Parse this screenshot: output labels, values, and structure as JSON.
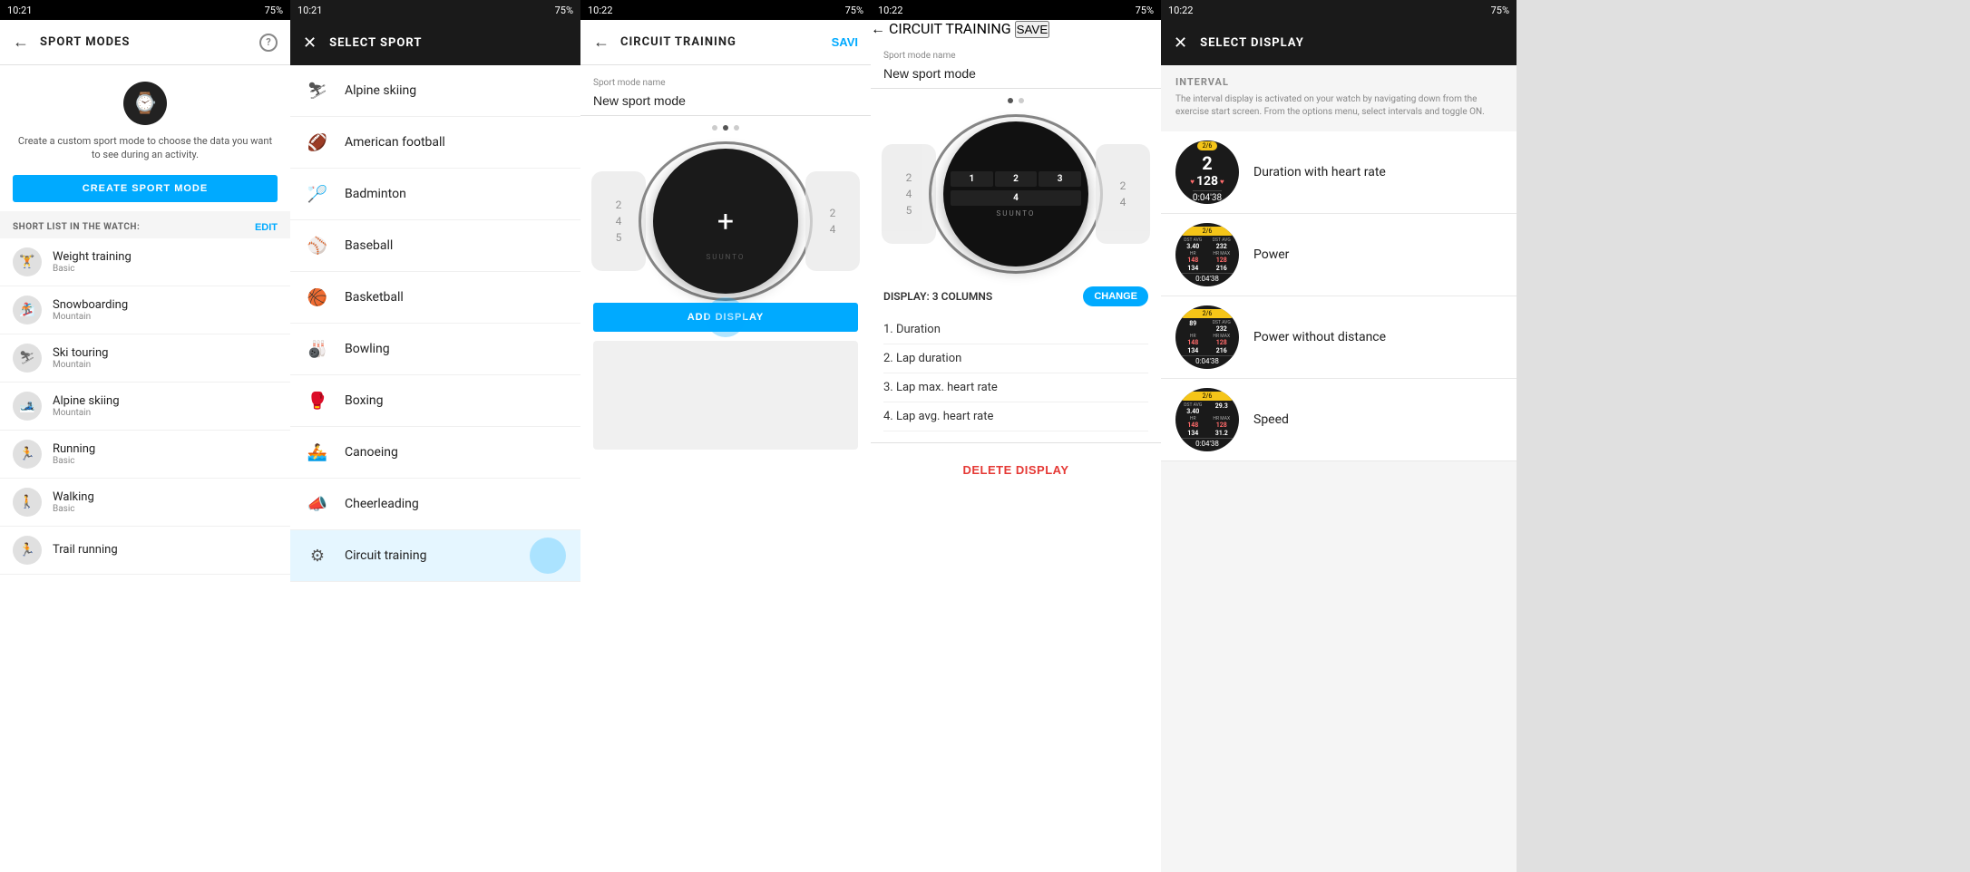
{
  "panel1": {
    "status_time": "10:21",
    "status_battery": "75%",
    "header_title": "SPORT MODES",
    "hero_text": "Create a custom sport mode to choose the data you want to see during an activity.",
    "create_btn_label": "CREATE SPORT MODE",
    "short_list_label": "SHORT LIST IN THE WATCH:",
    "edit_label": "EDIT",
    "sport_items": [
      {
        "name": "Weight training",
        "sub": "Basic",
        "icon": "🏋"
      },
      {
        "name": "Snowboarding",
        "sub": "Mountain",
        "icon": "🏂"
      },
      {
        "name": "Ski touring",
        "sub": "Mountain",
        "icon": "⛷"
      },
      {
        "name": "Alpine skiing",
        "sub": "Mountain",
        "icon": "🎿"
      },
      {
        "name": "Running",
        "sub": "Basic",
        "icon": "🏃"
      },
      {
        "name": "Walking",
        "sub": "Basic",
        "icon": "🚶"
      },
      {
        "name": "Trail running",
        "sub": "",
        "icon": "🏃"
      }
    ]
  },
  "panel2": {
    "status_time": "10:21",
    "status_battery": "75%",
    "header_title": "SELECT SPORT",
    "sports": [
      {
        "name": "Alpine skiing",
        "icon": "⛷"
      },
      {
        "name": "American football",
        "icon": "🏈"
      },
      {
        "name": "Badminton",
        "icon": "🏸"
      },
      {
        "name": "Baseball",
        "icon": "⚾"
      },
      {
        "name": "Basketball",
        "icon": "🏀"
      },
      {
        "name": "Bowling",
        "icon": "🎳"
      },
      {
        "name": "Boxing",
        "icon": "🥊"
      },
      {
        "name": "Canoeing",
        "icon": "🚣"
      },
      {
        "name": "Cheerleading",
        "icon": "📣"
      },
      {
        "name": "Circuit training",
        "icon": "⚙"
      }
    ]
  },
  "panel3": {
    "status_time": "10:22",
    "status_battery": "75%",
    "header_title": "CIRCUIT TRAINING",
    "save_label": "SAVI",
    "sport_mode_name_label": "Sport mode name",
    "sport_mode_name_value": "New sport mode",
    "dots": [
      0,
      1,
      2
    ],
    "active_dot": 1,
    "add_display_label": "ADD DISPLAY",
    "watch_brand": "SUUNTO"
  },
  "panel4": {
    "status_time": "10:22",
    "status_battery": "75%",
    "header_title": "CIRCUIT TRAINING",
    "save_label": "SAVE",
    "sport_mode_name_label": "Sport mode name",
    "sport_mode_name_value": "New sport mode",
    "display_columns_label": "DISPLAY: 3 COLUMNS",
    "change_label": "CHANGE",
    "display_items": [
      "1. Duration",
      "2. Lap duration",
      "3. Lap max. heart rate",
      "4. Lap avg. heart rate"
    ],
    "delete_display_label": "DELETE DISPLAY"
  },
  "panel5": {
    "status_time": "10:22",
    "status_battery": "75%",
    "header_title": "SELECT DISPLAY",
    "interval_label": "INTERVAL",
    "interval_desc": "The interval display is activated on your watch by navigating down from the exercise start screen. From the options menu, select intervals and toggle ON.",
    "display_options": [
      {
        "name": "Duration with heart rate",
        "badge": "2/6",
        "type": "duration_hr",
        "big_num": "2",
        "hr_val": "128",
        "time_val": "0:04'38"
      },
      {
        "name": "Power",
        "badge": "2/6",
        "type": "power_grid",
        "rows": [
          [
            {
              "label": "DST AVG",
              "val": "3.40"
            },
            {
              "label": "DST AVG",
              "val": "232"
            }
          ],
          [
            {
              "label": "HR",
              "val": "148",
              "hr": true
            },
            {
              "label": "HR MAX",
              "val": "128",
              "hr": true
            }
          ],
          [
            {
              "label": "",
              "val": "134"
            },
            {
              "label": "",
              "val": "216"
            }
          ]
        ],
        "time_val": "0:04'38"
      },
      {
        "name": "Power without distance",
        "badge": "2/6",
        "type": "power_nodist",
        "rows": [
          [
            {
              "label": "",
              "val": "89"
            },
            {
              "label": "DST AVG",
              "val": "232"
            }
          ],
          [
            {
              "label": "HR",
              "val": "148",
              "hr": true
            },
            {
              "label": "HR MAX",
              "val": "128",
              "hr": true
            }
          ],
          [
            {
              "label": "",
              "val": "134"
            },
            {
              "label": "",
              "val": "216"
            }
          ]
        ],
        "time_val": "0:04'38"
      },
      {
        "name": "Speed",
        "badge": "2/6",
        "type": "speed_grid",
        "rows": [
          [
            {
              "label": "DST AVG",
              "val": "3.40"
            },
            {
              "label": "",
              "val": "29.3"
            }
          ],
          [
            {
              "label": "HR",
              "val": "148",
              "hr": true
            },
            {
              "label": "HR MAX",
              "val": "128",
              "hr": true
            }
          ],
          [
            {
              "label": "",
              "val": "134"
            },
            {
              "label": "",
              "val": "31.2"
            }
          ]
        ],
        "time_val": "0:04'38"
      }
    ]
  }
}
